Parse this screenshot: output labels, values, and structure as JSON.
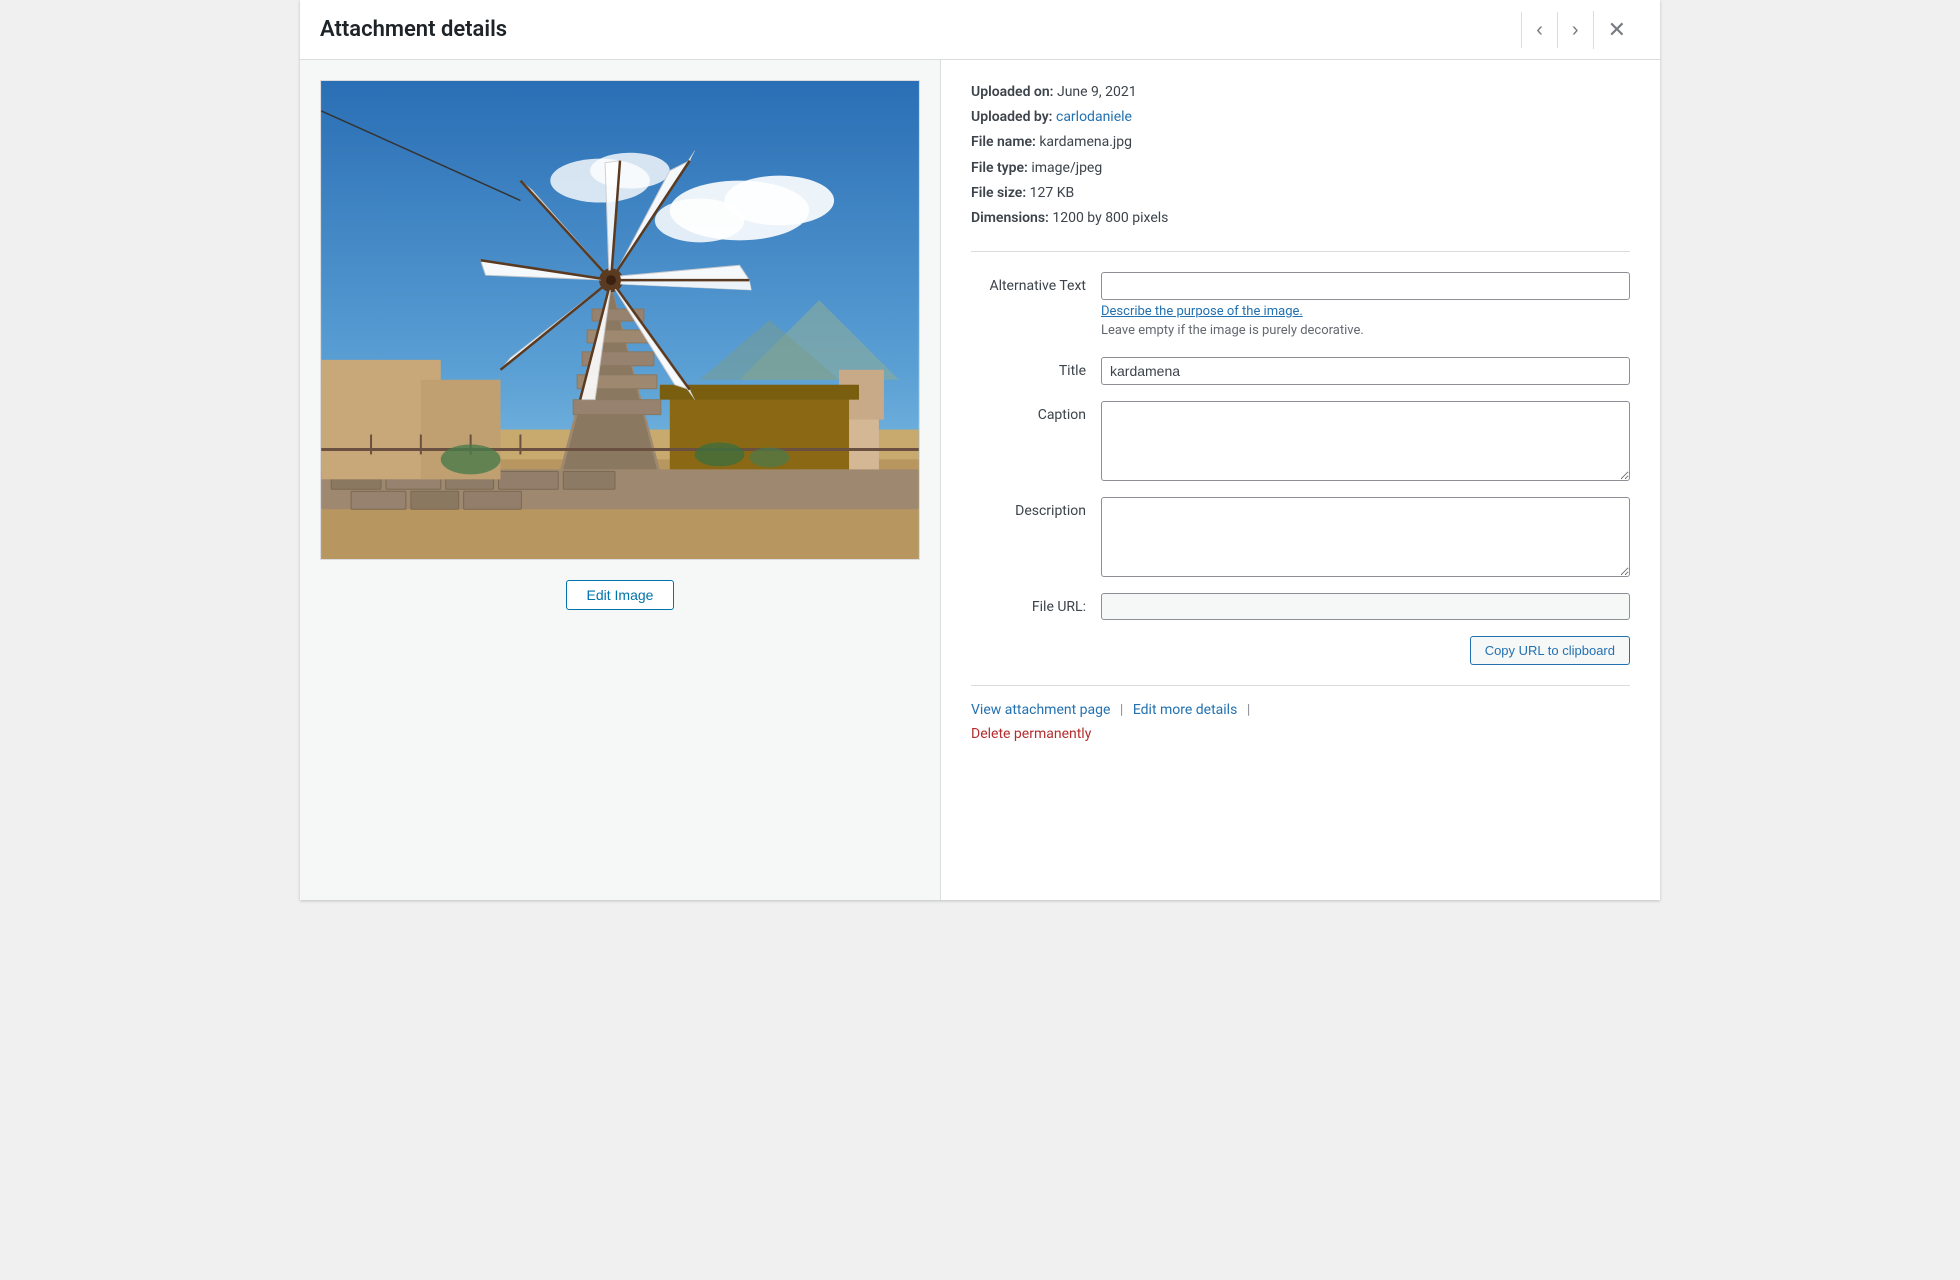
{
  "header": {
    "title": "Attachment details",
    "prev_label": "‹",
    "next_label": "›",
    "close_label": "✕"
  },
  "file_info": {
    "uploaded_on_label": "Uploaded on:",
    "uploaded_on_value": "June 9, 2021",
    "uploaded_by_label": "Uploaded by:",
    "uploaded_by_value": "carlodaniele",
    "file_name_label": "File name:",
    "file_name_value": "kardamena.jpg",
    "file_type_label": "File type:",
    "file_type_value": "image/jpeg",
    "file_size_label": "File size:",
    "file_size_value": "127 KB",
    "dimensions_label": "Dimensions:",
    "dimensions_value": "1200 by 800 pixels"
  },
  "form": {
    "alt_text_label": "Alternative Text",
    "alt_text_value": "",
    "alt_text_link": "Describe the purpose of the image.",
    "alt_text_hint": "Leave empty if the image is purely decorative.",
    "title_label": "Title",
    "title_value": "kardamena",
    "caption_label": "Caption",
    "caption_value": "",
    "description_label": "Description",
    "description_value": "",
    "file_url_label": "File URL:",
    "file_url_value": "",
    "copy_url_label": "Copy URL to clipboard"
  },
  "footer": {
    "view_attachment_label": "View attachment page",
    "edit_more_label": "Edit more details",
    "delete_label": "Delete permanently"
  },
  "edit_image_button": "Edit Image"
}
